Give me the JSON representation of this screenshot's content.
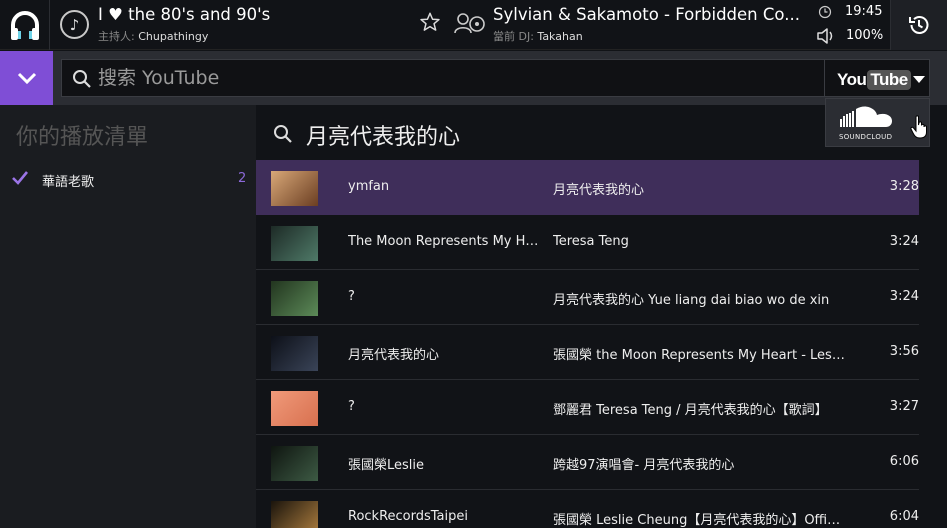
{
  "header": {
    "room_title": "I ♥ the 80's and 90's",
    "host_label": "主持人:",
    "host_name": "Chupathingy",
    "song_title": "Sylvian & Sakamoto - Forbidden Co...",
    "dj_label": "當前 DJ:",
    "dj_name": "Takahan",
    "time": "19:45",
    "volume": "100%"
  },
  "search": {
    "placeholder": "搜索 YouTube",
    "source_selected": "YouTube",
    "source_logo_you": "You",
    "source_logo_tube": "Tube",
    "dropdown_option": "SOUNDCLOUD"
  },
  "sidebar": {
    "title": "你的播放清單",
    "playlists": [
      {
        "name": "華語老歌",
        "count": "2"
      }
    ]
  },
  "results": {
    "query": "月亮代表我的心",
    "rows": [
      {
        "author": "ymfan",
        "title": "月亮代表我的心",
        "duration": "3:28",
        "thumb": "#b57a4a"
      },
      {
        "author": "The Moon Represents My Heart",
        "title": "Teresa Teng",
        "duration": "3:24",
        "thumb": "#2f4a40"
      },
      {
        "author": "?",
        "title": "月亮代表我的心 Yue liang dai biao wo de xin",
        "duration": "3:24",
        "thumb": "#3b5a3a"
      },
      {
        "author": "月亮代表我的心",
        "title": "張國榮 the Moon Represents My Heart - Leslie",
        "duration": "3:56",
        "thumb": "#1c2230"
      },
      {
        "author": "?",
        "title": "鄧麗君 Teresa Teng / 月亮代表我的心【歌詞】",
        "duration": "3:27",
        "thumb": "#e4856a"
      },
      {
        "author": "張國榮Leslie",
        "title": "跨越97演唱會- 月亮代表我的心",
        "duration": "6:06",
        "thumb": "#1e2a22"
      },
      {
        "author": "RockRecordsTaipei",
        "title": "張國榮 Leslie Cheung【月亮代表我的心】Official",
        "duration": "6:04",
        "thumb": "#2a2218"
      }
    ]
  },
  "colors": {
    "accent": "#7f4ed6",
    "selected_row": "#3f2e5a",
    "count": "#8c69d9"
  }
}
